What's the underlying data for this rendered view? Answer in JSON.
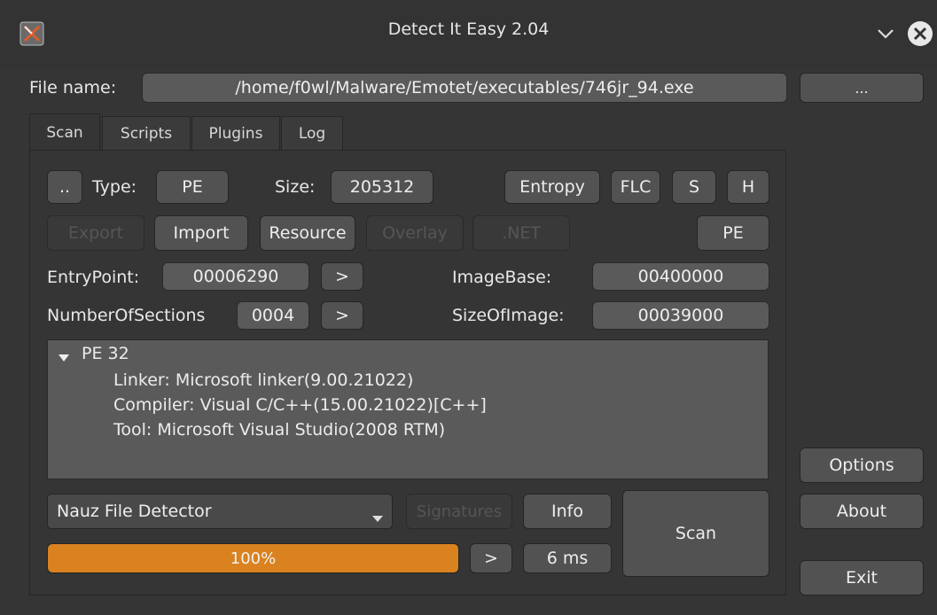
{
  "window": {
    "title": "Detect It Easy 2.04"
  },
  "file": {
    "label": "File name:",
    "path": "/home/f0wl/Malware/Emotet/executables/746jr_94.exe",
    "browse_label": "..."
  },
  "tabs": [
    "Scan",
    "Scripts",
    "Plugins",
    "Log"
  ],
  "scan": {
    "up_label": "..",
    "type_label": "Type:",
    "type_value": "PE",
    "size_label": "Size:",
    "size_value": "205312",
    "entropy_label": "Entropy",
    "flc_label": "FLC",
    "s_label": "S",
    "h_label": "H",
    "export_label": "Export",
    "import_label": "Import",
    "resource_label": "Resource",
    "overlay_label": "Overlay",
    "net_label": ".NET",
    "pe_label": "PE",
    "entrypoint_label": "EntryPoint:",
    "entrypoint_value": "00006290",
    "imagebase_label": "ImageBase:",
    "imagebase_value": "00400000",
    "sections_label": "NumberOfSections",
    "sections_value": "0004",
    "sizeofimage_label": "SizeOfImage:",
    "sizeofimage_value": "00039000",
    "go_label": ">"
  },
  "results": {
    "root": "PE 32",
    "items": [
      "Linker: Microsoft linker(9.00.21022)",
      "Compiler: Visual C/C++(15.00.21022)[C++]",
      "Tool: Microsoft Visual Studio(2008 RTM)"
    ]
  },
  "bottom": {
    "detector": "Nauz File Detector",
    "signatures_label": "Signatures",
    "info_label": "Info",
    "scan_label": "Scan",
    "progress_text": "100%",
    "progress_value": 100,
    "next_label": ">",
    "time_text": "6 ms"
  },
  "side": {
    "options_label": "Options",
    "about_label": "About",
    "exit_label": "Exit"
  },
  "colors": {
    "progress": "#d9821f",
    "background": "#353535"
  }
}
